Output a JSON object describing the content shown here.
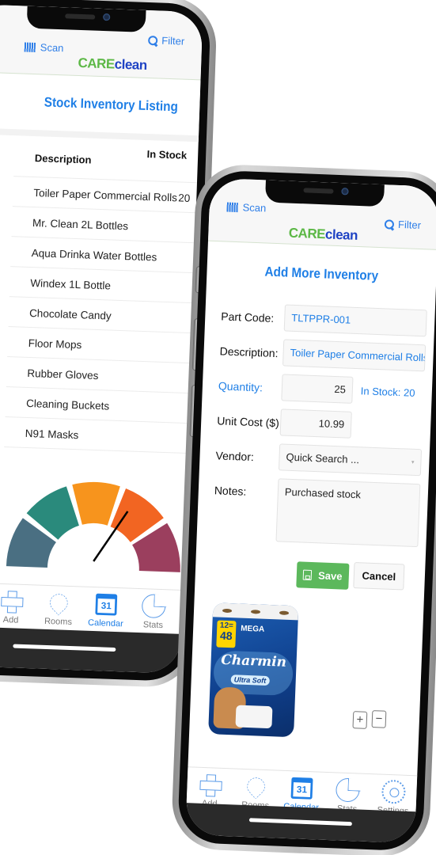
{
  "app": {
    "logo_care": "CARE",
    "logo_clean": "clean",
    "scan_label": "Scan",
    "filter_label": "Filter"
  },
  "listing_screen": {
    "title": "Stock Inventory Listing",
    "columns": {
      "description": "Description",
      "in_stock": "In Stock"
    },
    "rows": [
      {
        "description": "Toiler Paper Commercial Rolls",
        "in_stock": "20"
      },
      {
        "description": "Mr. Clean 2L Bottles",
        "in_stock": ""
      },
      {
        "description": "Aqua Drinka Water Bottles",
        "in_stock": ""
      },
      {
        "description": "Windex 1L Bottle",
        "in_stock": ""
      },
      {
        "description": "Chocolate Candy",
        "in_stock": ""
      },
      {
        "description": "Floor Mops",
        "in_stock": ""
      },
      {
        "description": "Rubber Gloves",
        "in_stock": ""
      },
      {
        "description": "Cleaning Buckets",
        "in_stock": ""
      },
      {
        "description": "N91 Masks",
        "in_stock": ""
      }
    ],
    "gauge": {
      "segment_colors": [
        "#4a6f82",
        "#2a8a7c",
        "#f7941d",
        "#f26522",
        "#9b3f5e"
      ],
      "needle_level": 0.66
    },
    "tabs": [
      {
        "label": "Add",
        "icon": "plus-icon",
        "active": false
      },
      {
        "label": "Rooms",
        "icon": "map-pin-icon",
        "active": false
      },
      {
        "label": "Calendar",
        "icon": "calendar-icon",
        "active": true,
        "icon_text": "31"
      },
      {
        "label": "Stats",
        "icon": "pie-chart-icon",
        "active": false
      }
    ]
  },
  "add_screen": {
    "title": "Add More Inventory",
    "fields": {
      "part_code": {
        "label": "Part Code:",
        "value": "TLTPPR-001"
      },
      "description": {
        "label": "Description:",
        "value": "Toiler Paper Commercial Rolls"
      },
      "quantity": {
        "label": "Quantity:",
        "value": "25"
      },
      "in_stock": {
        "label": "In Stock:",
        "value": "20"
      },
      "unit_cost": {
        "label": "Unit Cost ($)",
        "value": "10.99"
      },
      "vendor": {
        "label": "Vendor:",
        "placeholder": "Quick Search ..."
      },
      "notes": {
        "label": "Notes:",
        "value": "Purchased stock"
      }
    },
    "buttons": {
      "save": "Save",
      "cancel": "Cancel"
    },
    "product_image": {
      "badge_top": "12=",
      "badge_bottom": "48",
      "pack_label": "MEGA",
      "brand": "Charmin",
      "variant": "Ultra Soft"
    },
    "zoom_controls": {
      "zoom_in": "+",
      "zoom_out": "−"
    },
    "tabs": [
      {
        "label": "Add",
        "icon": "plus-icon",
        "active": false
      },
      {
        "label": "Rooms",
        "icon": "map-pin-icon",
        "active": false
      },
      {
        "label": "Calendar",
        "icon": "calendar-icon",
        "active": true,
        "icon_text": "31"
      },
      {
        "label": "Stats",
        "icon": "pie-chart-icon",
        "active": false
      },
      {
        "label": "Settings",
        "icon": "gear-icon",
        "active": false
      }
    ]
  }
}
